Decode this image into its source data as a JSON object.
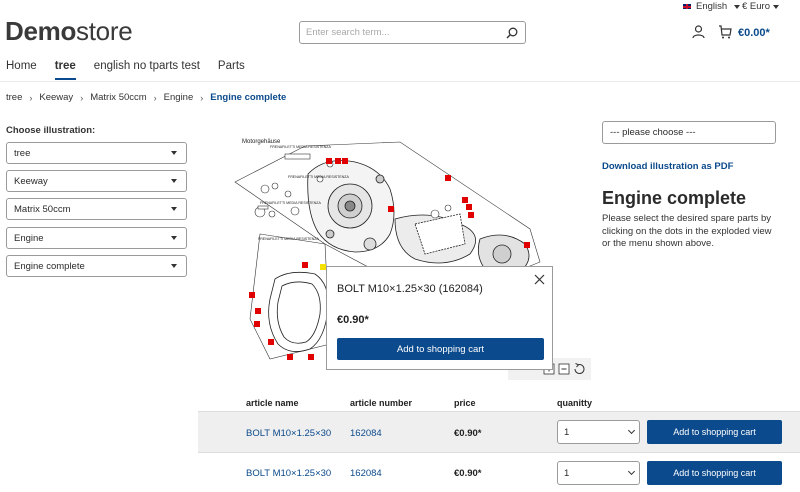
{
  "topbar": {
    "language": "English",
    "currency": "€ Euro"
  },
  "logo": {
    "bold": "Demo",
    "light": "store"
  },
  "search": {
    "placeholder": "Enter search term..."
  },
  "cart": {
    "total": "€0.00*"
  },
  "nav": [
    "Home",
    "tree",
    "english no tparts test",
    "Parts"
  ],
  "breadcrumb": [
    "tree",
    "Keeway",
    "Matrix 50ccm",
    "Engine",
    "Engine complete"
  ],
  "sidebar": {
    "label": "Choose illustration:",
    "selects": [
      "tree",
      "Keeway",
      "Matrix 50ccm",
      "Engine",
      "Engine complete"
    ]
  },
  "right": {
    "select": "--- please choose ---",
    "pdf_link": "Download illustration as PDF",
    "title": "Engine complete",
    "description": "Please select the desired spare parts by clicking on the dots in the exploded view or the menu shown above."
  },
  "illustration": {
    "heading": "Motorgehäuse",
    "labels": [
      "FRENAFILETTI MEDIA RESISTENZA",
      "FRENAFILETTI MEDIA RESISTENZA",
      "FRENAFILETTI MEDIA RESISTENZA",
      "FRENAFILETTI MEDIA RESISTENZA"
    ]
  },
  "popup": {
    "title": "BOLT M10×1.25×30 (162084)",
    "price": "€0.90*",
    "button": "Add to shopping cart"
  },
  "table": {
    "headers": [
      "article name",
      "article number",
      "price",
      "quanitty"
    ],
    "rows": [
      {
        "name": "BOLT M10×1.25×30",
        "number": "162084",
        "price": "€0.90*",
        "qty": "1",
        "button": "Add to shopping cart"
      },
      {
        "name": "BOLT M10×1.25×30",
        "number": "162084",
        "price": "€0.90*",
        "qty": "1",
        "button": "Add to shopping cart"
      }
    ]
  },
  "colors": {
    "accent": "#0b4a8c",
    "hotspot": "#e00000",
    "hotspot_active": "#f5e000"
  }
}
